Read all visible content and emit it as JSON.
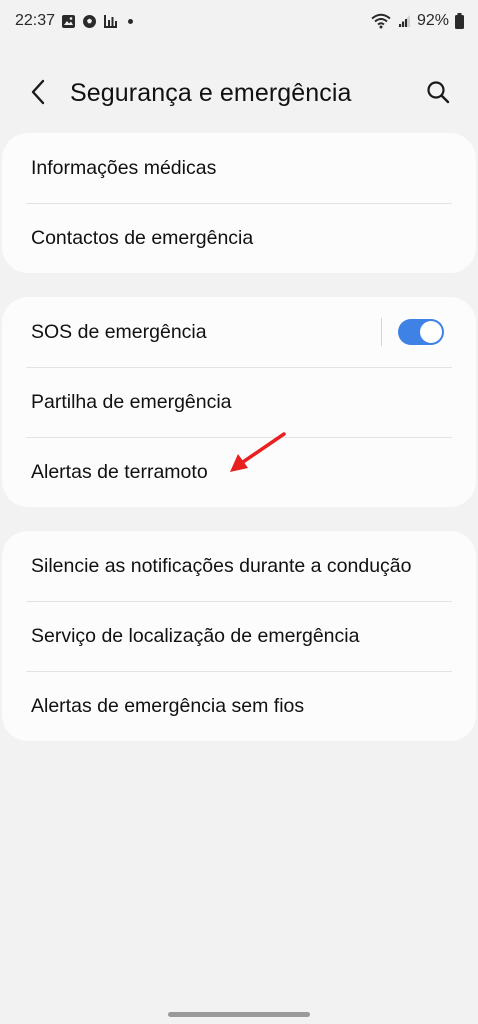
{
  "status_bar": {
    "time": "22:37",
    "battery": "92%",
    "icons_left": [
      "gallery-icon",
      "soccer-ball-icon",
      "chart-bars-icon",
      "dot-icon"
    ],
    "icons_right": [
      "wifi-icon",
      "signal-icon",
      "battery-icon"
    ]
  },
  "header": {
    "title": "Segurança e emergência",
    "back_icon": "chevron-left-icon",
    "search_icon": "search-icon"
  },
  "groups": [
    {
      "items": [
        {
          "label": "Informações médicas"
        },
        {
          "label": "Contactos de emergência"
        }
      ]
    },
    {
      "items": [
        {
          "label": "SOS de emergência",
          "toggle": true,
          "toggle_on": true
        },
        {
          "label": "Partilha de emergência"
        },
        {
          "label": "Alertas de terramoto",
          "annotated": true
        }
      ]
    },
    {
      "items": [
        {
          "label": "Silencie as notificações durante a condução"
        },
        {
          "label": "Serviço de localização de emergência"
        },
        {
          "label": "Alertas de emergência sem fios"
        }
      ]
    }
  ],
  "colors": {
    "background": "#f2f2f2",
    "card": "#fcfcfc",
    "toggle_on": "#3e82e5",
    "annotation_arrow": "#e8201f"
  }
}
